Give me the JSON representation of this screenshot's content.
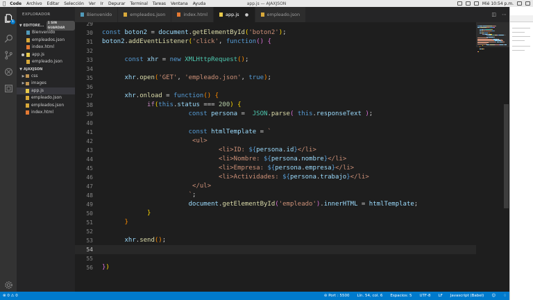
{
  "menubar": {
    "app": "Code",
    "items": [
      "Archivo",
      "Editar",
      "Selección",
      "Ver",
      "Ir",
      "Depurar",
      "Terminal",
      "Tareas",
      "Ventana",
      "Ayuda"
    ],
    "window_title": "app.js — AJAXJSON",
    "clock": "Mié 10:54 p.m."
  },
  "sidebar": {
    "title": "EXPLORADOR",
    "open_editors": {
      "label": "EDITORE...",
      "badge": "1 SIN GUARDAR",
      "items": [
        {
          "name": "Bienvenido",
          "icon": "markdown-icon"
        },
        {
          "name": "empleados.json",
          "icon": "json-icon"
        },
        {
          "name": "index.html",
          "icon": "html-icon"
        },
        {
          "name": "app.js",
          "icon": "js-icon",
          "modified": true
        },
        {
          "name": "empleado.json",
          "icon": "json-icon"
        }
      ]
    },
    "workspace": {
      "label": "AJAXJSON",
      "items": [
        {
          "name": "css",
          "type": "folder"
        },
        {
          "name": "images",
          "type": "folder"
        },
        {
          "name": "app.js",
          "type": "js",
          "selected": true
        },
        {
          "name": "empleado.json",
          "type": "json"
        },
        {
          "name": "empleados.json",
          "type": "json"
        },
        {
          "name": "index.html",
          "type": "html"
        }
      ]
    }
  },
  "tabs": [
    {
      "label": "Bienvenido",
      "icon": "markdown"
    },
    {
      "label": "empleados.json",
      "icon": "json"
    },
    {
      "label": "index.html",
      "icon": "html"
    },
    {
      "label": "app.js",
      "icon": "js",
      "active": true
    },
    {
      "label": "empleado.json",
      "icon": "json"
    }
  ],
  "editor": {
    "current_line": 54,
    "lines": [
      {
        "n": "29",
        "tokens": []
      },
      {
        "n": "30",
        "tokens": [
          [
            "k",
            "const "
          ],
          [
            "v",
            "boton2"
          ],
          [
            "p",
            " = "
          ],
          [
            "v",
            "document"
          ],
          [
            "p",
            "."
          ],
          [
            "f",
            "getElementById"
          ],
          [
            "y",
            "("
          ],
          [
            "s",
            "'boton2'"
          ],
          [
            "y",
            ")"
          ],
          [
            "p",
            ";"
          ]
        ]
      },
      {
        "n": "31",
        "tokens": [
          [
            "v",
            "boton2"
          ],
          [
            "p",
            "."
          ],
          [
            "f",
            "addEventListener"
          ],
          [
            "y",
            "("
          ],
          [
            "s",
            "'click'"
          ],
          [
            "p",
            ", "
          ],
          [
            "k",
            "function"
          ],
          [
            "m",
            "()"
          ],
          [
            "p",
            " "
          ],
          [
            "m",
            "{"
          ]
        ]
      },
      {
        "n": "32",
        "tokens": []
      },
      {
        "n": "33",
        "tokens": [
          [
            "p",
            "      "
          ],
          [
            "k",
            "const "
          ],
          [
            "v",
            "xhr"
          ],
          [
            "p",
            " = "
          ],
          [
            "k",
            "new "
          ],
          [
            "c",
            "XMLHttpRequest"
          ],
          [
            "o",
            "()"
          ],
          [
            "p",
            ";"
          ]
        ]
      },
      {
        "n": "34",
        "tokens": []
      },
      {
        "n": "35",
        "tokens": [
          [
            "p",
            "      "
          ],
          [
            "v",
            "xhr"
          ],
          [
            "p",
            "."
          ],
          [
            "f",
            "open"
          ],
          [
            "o",
            "("
          ],
          [
            "s",
            "'GET'"
          ],
          [
            "p",
            ", "
          ],
          [
            "s",
            "'empleado.json'"
          ],
          [
            "p",
            ", "
          ],
          [
            "k",
            "true"
          ],
          [
            "o",
            ")"
          ],
          [
            "p",
            ";"
          ]
        ]
      },
      {
        "n": "36",
        "tokens": []
      },
      {
        "n": "37",
        "tokens": [
          [
            "p",
            "      "
          ],
          [
            "v",
            "xhr"
          ],
          [
            "p",
            "."
          ],
          [
            "f",
            "onload"
          ],
          [
            "p",
            " = "
          ],
          [
            "k",
            "function"
          ],
          [
            "o",
            "()"
          ],
          [
            "p",
            " "
          ],
          [
            "o",
            "{"
          ]
        ]
      },
      {
        "n": "38",
        "tokens": [
          [
            "p",
            "            "
          ],
          [
            "lk",
            "if"
          ],
          [
            "y",
            "("
          ],
          [
            "k",
            "this"
          ],
          [
            "p",
            "."
          ],
          [
            "v",
            "status"
          ],
          [
            "p",
            " === "
          ],
          [
            "n",
            "200"
          ],
          [
            "y",
            ")"
          ],
          [
            "p",
            " "
          ],
          [
            "y",
            "{"
          ]
        ]
      },
      {
        "n": "39",
        "tokens": [
          [
            "p",
            "                       "
          ],
          [
            "k",
            "const "
          ],
          [
            "v",
            "persona"
          ],
          [
            "p",
            " =  "
          ],
          [
            "c",
            "JSON"
          ],
          [
            "p",
            "."
          ],
          [
            "f",
            "parse"
          ],
          [
            "m",
            "("
          ],
          [
            "p",
            " "
          ],
          [
            "k",
            "this"
          ],
          [
            "p",
            "."
          ],
          [
            "v",
            "responseText"
          ],
          [
            "p",
            " "
          ],
          [
            "m",
            ")"
          ],
          [
            "p",
            ";"
          ]
        ]
      },
      {
        "n": "40",
        "tokens": []
      },
      {
        "n": "41",
        "tokens": [
          [
            "p",
            "                       "
          ],
          [
            "k",
            "const "
          ],
          [
            "v",
            "htmlTemplate"
          ],
          [
            "p",
            " = "
          ],
          [
            "s",
            "`"
          ]
        ]
      },
      {
        "n": "42",
        "tokens": [
          [
            "s",
            "                        <ul>"
          ]
        ]
      },
      {
        "n": "43",
        "tokens": [
          [
            "s",
            "                               <li>ID: "
          ],
          [
            "k",
            "${"
          ],
          [
            "v",
            "persona"
          ],
          [
            "p",
            "."
          ],
          [
            "v",
            "id"
          ],
          [
            "k",
            "}"
          ],
          [
            "s",
            "</li>"
          ]
        ]
      },
      {
        "n": "44",
        "tokens": [
          [
            "s",
            "                               <li>Nombre: "
          ],
          [
            "k",
            "${"
          ],
          [
            "v",
            "persona"
          ],
          [
            "p",
            "."
          ],
          [
            "v",
            "nombre"
          ],
          [
            "k",
            "}"
          ],
          [
            "s",
            "</li>"
          ]
        ]
      },
      {
        "n": "45",
        "tokens": [
          [
            "s",
            "                               <li>Empresa: "
          ],
          [
            "k",
            "${"
          ],
          [
            "v",
            "persona"
          ],
          [
            "p",
            "."
          ],
          [
            "v",
            "empresa"
          ],
          [
            "k",
            "}"
          ],
          [
            "s",
            "</li>"
          ]
        ]
      },
      {
        "n": "46",
        "tokens": [
          [
            "s",
            "                               <li>Actividades: "
          ],
          [
            "k",
            "${"
          ],
          [
            "v",
            "persona"
          ],
          [
            "p",
            "."
          ],
          [
            "v",
            "trabajo"
          ],
          [
            "k",
            "}"
          ],
          [
            "s",
            "</li>"
          ]
        ]
      },
      {
        "n": "47",
        "tokens": [
          [
            "s",
            "                        </ul>"
          ]
        ]
      },
      {
        "n": "48",
        "tokens": [
          [
            "s",
            "                       `"
          ],
          [
            "p",
            ";"
          ]
        ]
      },
      {
        "n": "49",
        "tokens": [
          [
            "p",
            "                       "
          ],
          [
            "v",
            "document"
          ],
          [
            "p",
            "."
          ],
          [
            "f",
            "getElementById"
          ],
          [
            "m",
            "("
          ],
          [
            "s",
            "'empleado'"
          ],
          [
            "m",
            ")"
          ],
          [
            "p",
            "."
          ],
          [
            "v",
            "innerHTML"
          ],
          [
            "p",
            " = "
          ],
          [
            "v",
            "htmlTemplate"
          ],
          [
            "p",
            ";"
          ]
        ]
      },
      {
        "n": "50",
        "tokens": [
          [
            "p",
            "            "
          ],
          [
            "y",
            "}"
          ]
        ]
      },
      {
        "n": "51",
        "tokens": [
          [
            "p",
            "      "
          ],
          [
            "o",
            "}"
          ]
        ]
      },
      {
        "n": "52",
        "tokens": []
      },
      {
        "n": "53",
        "tokens": [
          [
            "p",
            "      "
          ],
          [
            "v",
            "xhr"
          ],
          [
            "p",
            "."
          ],
          [
            "f",
            "send"
          ],
          [
            "o",
            "()"
          ],
          [
            "p",
            ";"
          ]
        ]
      },
      {
        "n": "54",
        "tokens": []
      },
      {
        "n": "55",
        "tokens": []
      },
      {
        "n": "56",
        "tokens": [
          [
            "m",
            "}"
          ],
          [
            "y",
            ")"
          ]
        ]
      }
    ]
  },
  "statusbar": {
    "errors": "0",
    "warnings": "0",
    "port": "Port : 5500",
    "position": "Lín. 54, col. 6",
    "indent": "Espacios: 5",
    "encoding": "UTF-8",
    "eol": "LF",
    "language": "Javascript (Babel)"
  },
  "activity_badge": "1"
}
